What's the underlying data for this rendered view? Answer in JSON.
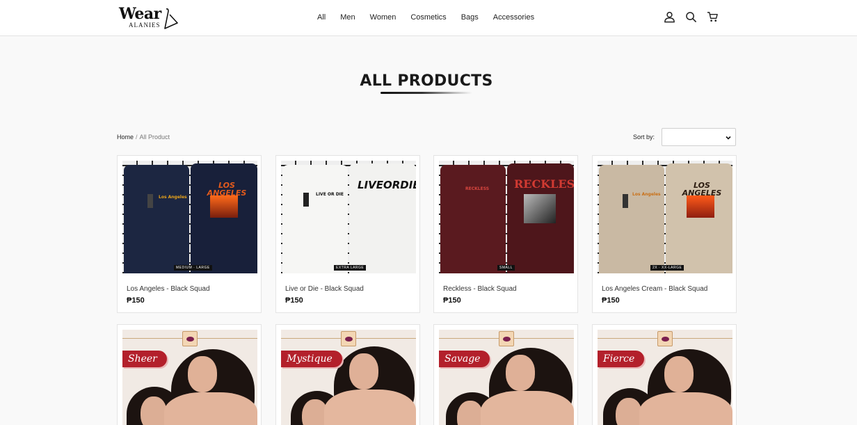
{
  "brand": {
    "logo_word": "Wear",
    "logo_sub": "ALANIES"
  },
  "nav": {
    "items": [
      "All",
      "Men",
      "Women",
      "Cosmetics",
      "Bags",
      "Accessories"
    ]
  },
  "header_icons": [
    "user-icon",
    "search-icon",
    "cart-icon"
  ],
  "page": {
    "title": "ALL PRODUCTS"
  },
  "breadcrumb": {
    "home": "Home",
    "separator": "/",
    "current": "All Product"
  },
  "sort": {
    "label": "Sort by:",
    "selected": ""
  },
  "products": [
    {
      "name": "Los Angeles - Black Squad",
      "price": "₱150",
      "shirt_color": "#1c2641",
      "tag": "MEDIUM · LARGE",
      "print": "LOS ANGELES"
    },
    {
      "name": "Live or Die - Black Squad",
      "price": "₱150",
      "shirt_color": "#f6f6f4",
      "tag": "EXTRA LARGE",
      "print": "LIVEORDIE"
    },
    {
      "name": "Reckless - Black Squad",
      "price": "₱150",
      "shirt_color": "#5a1a1f",
      "tag": "SMALL",
      "print": "RECKLESS"
    },
    {
      "name": "Los Angeles Cream - Black Squad",
      "price": "₱150",
      "shirt_color": "#c9b9a3",
      "tag": "2X · XX-LARGE",
      "print": "LOS ANGELES"
    }
  ],
  "cosmetics": [
    {
      "ribbon": "Sheer"
    },
    {
      "ribbon": "Mystique"
    },
    {
      "ribbon": "Savage"
    },
    {
      "ribbon": "Fierce"
    }
  ],
  "colors": {
    "accent_red": "#b3202b",
    "text_dark": "#1a1a1a",
    "background": "#f9f9f9"
  }
}
